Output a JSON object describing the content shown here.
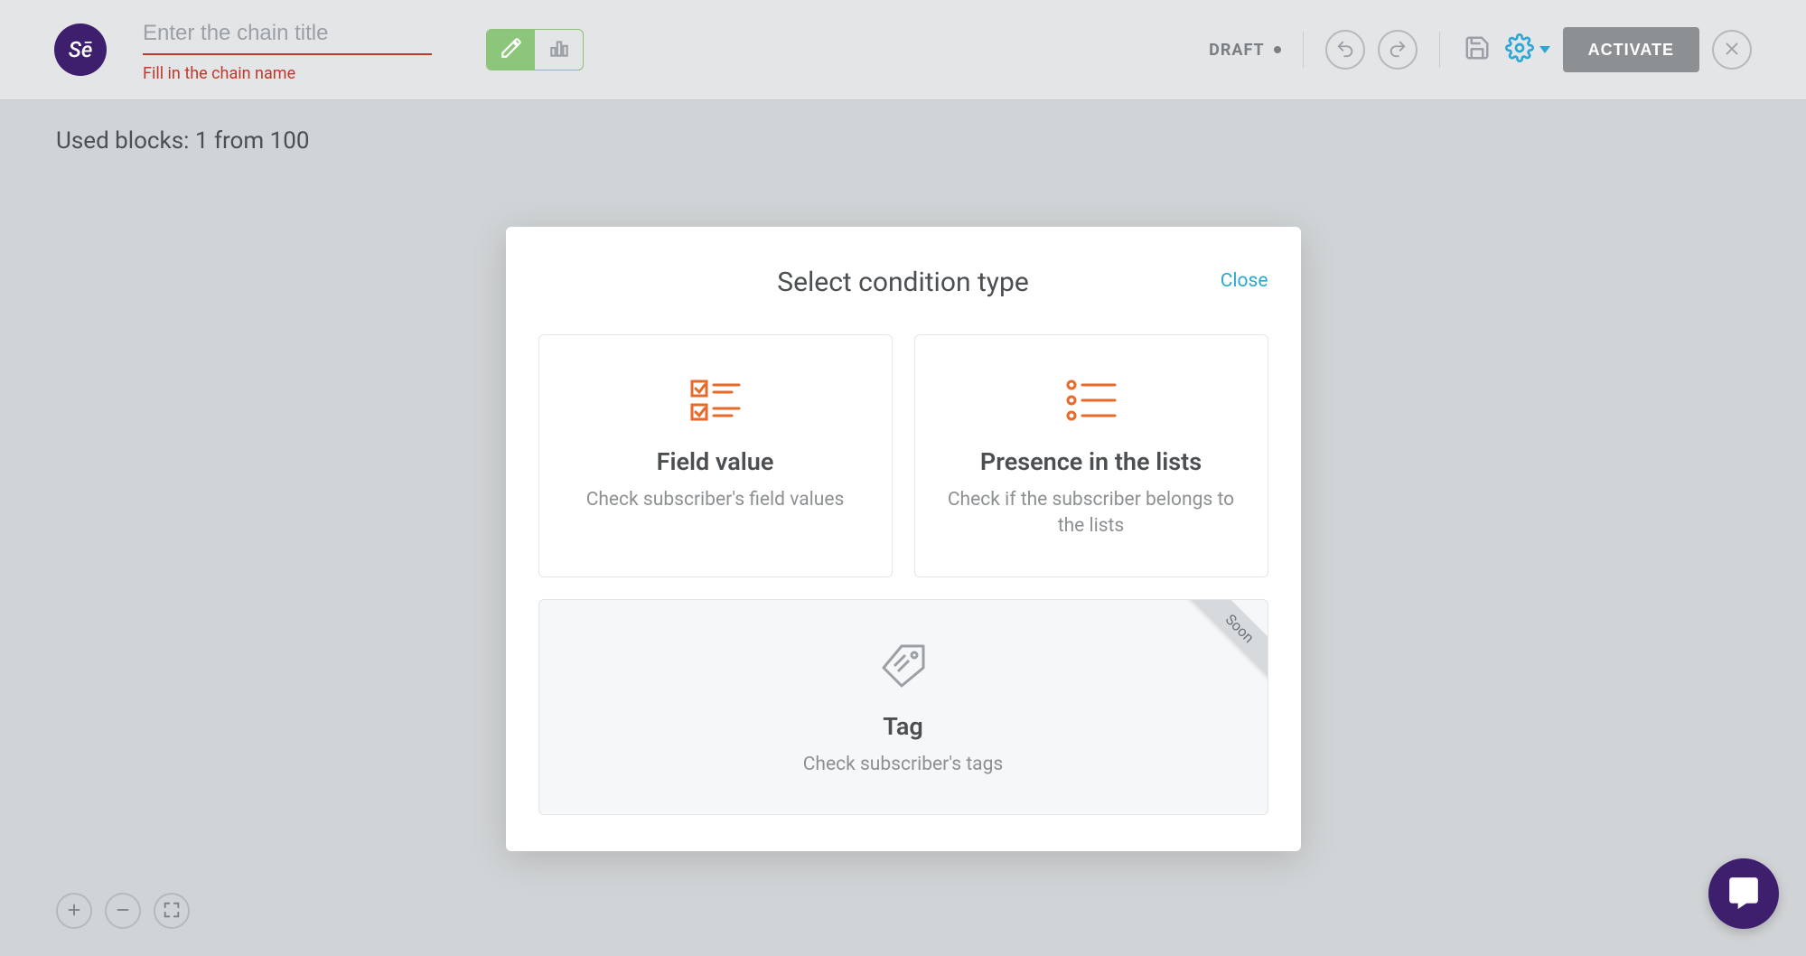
{
  "logo_text": "Sē",
  "title_input": {
    "value": "",
    "placeholder": "Enter the chain title",
    "error": "Fill in the chain name"
  },
  "status": {
    "label": "DRAFT"
  },
  "activate_label": "ACTIVATE",
  "used_blocks_text": "Used blocks: 1 from 100",
  "modal": {
    "title": "Select condition type",
    "close_label": "Close",
    "cards": {
      "field_value": {
        "title": "Field value",
        "desc": "Check subscriber's field values"
      },
      "presence": {
        "title": "Presence in the lists",
        "desc": "Check if the subscriber belongs to the lists"
      },
      "tag": {
        "title": "Tag",
        "desc": "Check subscriber's tags",
        "ribbon": "Soon"
      }
    }
  },
  "colors": {
    "accent_orange": "#e86a2a",
    "accent_blue": "#2aa7d6",
    "brand_purple": "#3e1f6e"
  }
}
